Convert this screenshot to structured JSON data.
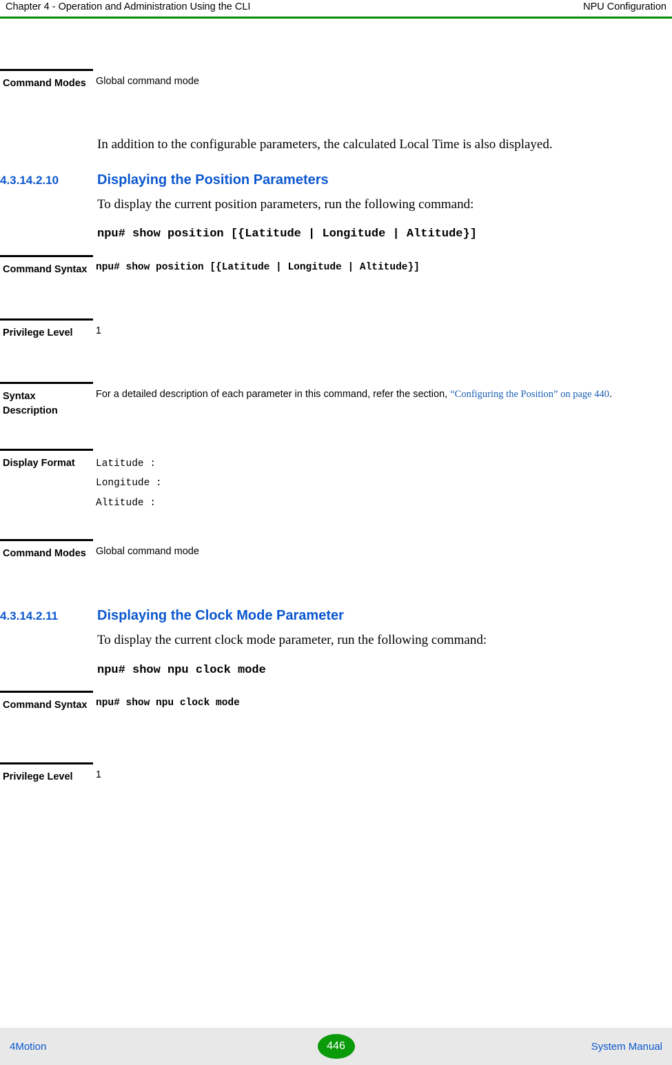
{
  "header": {
    "left": "Chapter 4 - Operation and Administration Using the CLI",
    "right": "NPU Configuration"
  },
  "blocks": {
    "table1": {
      "rows": [
        {
          "label": "Command Modes",
          "value": "Global command mode"
        }
      ]
    },
    "para1": "In addition to the configurable parameters, the calculated Local Time is also displayed.",
    "section1": {
      "number": "4.3.14.2.10",
      "title": "Displaying the Position Parameters",
      "intro": "To display the current position parameters, run the following command:",
      "command": "npu# show position [{Latitude | Longitude | Altitude}]"
    },
    "table2": {
      "rows": [
        {
          "label": "Command Syntax",
          "value": "npu# show position [{Latitude | Longitude | Altitude}]"
        },
        {
          "label": "Privilege Level",
          "value": "1"
        },
        {
          "label": "Syntax Description",
          "value_prefix": "For a detailed description of each parameter in this command, refer the section, ",
          "value_link": "“Configuring the Position” on page 440",
          "value_suffix": "."
        },
        {
          "label": "Display Format",
          "lines": [
            "Latitude       :",
            "Longitude      :",
            "Altitude       :"
          ]
        },
        {
          "label": "Command Modes",
          "value": "Global command mode"
        }
      ]
    },
    "section2": {
      "number": "4.3.14.2.11",
      "title": "Displaying the Clock Mode Parameter",
      "intro": "To display the current clock mode parameter, run the following command:",
      "command": "npu# show npu clock mode"
    },
    "table3": {
      "rows": [
        {
          "label": "Command Syntax",
          "value": "npu# show npu clock mode"
        },
        {
          "label": "Privilege Level",
          "value": "1"
        }
      ]
    }
  },
  "footer": {
    "left": "4Motion",
    "page": "446",
    "right": "System Manual"
  },
  "colors": {
    "accent_green": "#0a8a0a",
    "link_blue": "#0b57d0",
    "xref_blue": "#1a5fb4",
    "footer_bg": "#e8e8e8"
  }
}
